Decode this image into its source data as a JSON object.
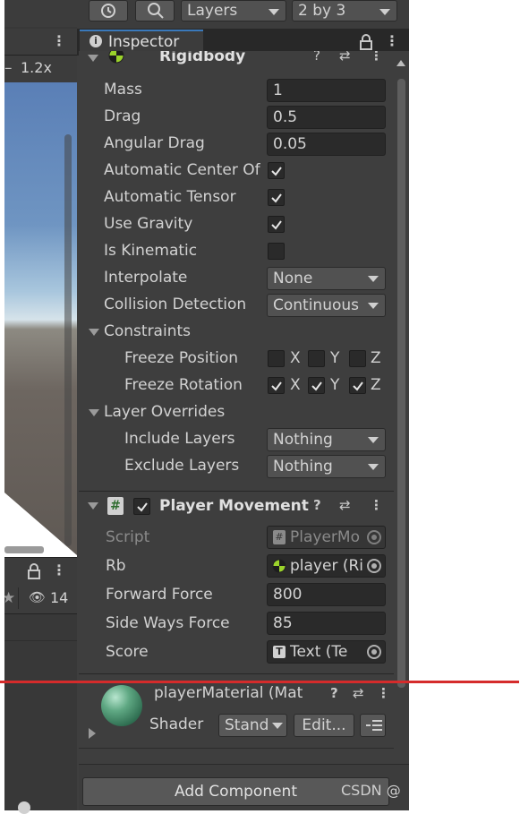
{
  "toolbar": {
    "layers_label": "Layers",
    "layout_label": "2 by 3"
  },
  "scene": {
    "zoom_label": "1.2x",
    "hidden_count": "14"
  },
  "inspector": {
    "tab_label": "Inspector",
    "rigidbody": {
      "title": "Rigidbody",
      "fields": [
        {
          "label": "Mass",
          "value": "1"
        },
        {
          "label": "Drag",
          "value": "0.5"
        },
        {
          "label": "Angular Drag",
          "value": "0.05"
        }
      ],
      "auto_center_label": "Automatic Center Of",
      "auto_tensor_label": "Automatic Tensor",
      "use_gravity_label": "Use Gravity",
      "is_kinematic_label": "Is Kinematic",
      "interpolate_label": "Interpolate",
      "interpolate_value": "None",
      "collision_label": "Collision Detection",
      "collision_value": "Continuous",
      "constraints_label": "Constraints",
      "freeze_position_label": "Freeze Position",
      "freeze_rotation_label": "Freeze Rotation",
      "axis_x": "X",
      "axis_y": "Y",
      "axis_z": "Z",
      "layer_overrides_label": "Layer Overrides",
      "include_layers_label": "Include Layers",
      "include_layers_value": "Nothing",
      "exclude_layers_label": "Exclude Layers",
      "exclude_layers_value": "Nothing"
    },
    "player_movement": {
      "title": "Player Movement",
      "script_label": "Script",
      "script_value": "PlayerMo",
      "rb_label": "Rb",
      "rb_value": "player (Ri",
      "forward_force_label": "Forward Force",
      "forward_force_value": "800",
      "side_force_label": "Side Ways Force",
      "side_force_value": "85",
      "score_label": "Score",
      "score_value": "Text  (Te"
    },
    "material": {
      "name": "playerMaterial (Mat",
      "shader_label": "Shader",
      "shader_value": "Stand",
      "edit_label": "Edit..."
    },
    "add_component_label": "Add Component"
  },
  "watermark": "CSDN @",
  "colors": {
    "accent_tab": "#3a79bb",
    "annotation_line": "#d52b2b",
    "panel_bg": "#3e3e3e",
    "field_bg": "#2a2a2a"
  }
}
